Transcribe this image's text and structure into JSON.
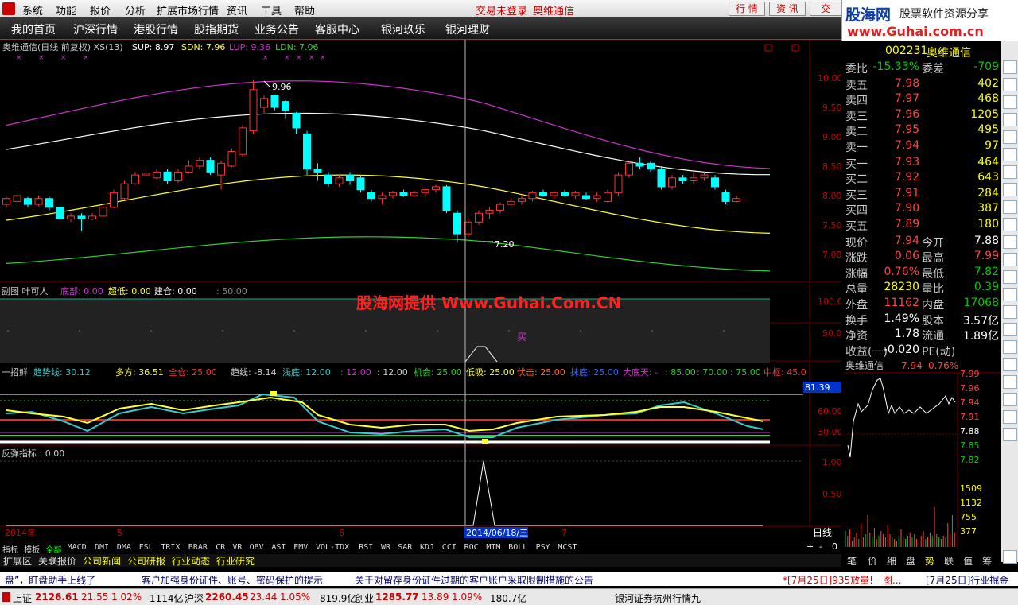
{
  "menu": {
    "items": [
      "系统",
      "功能",
      "报价",
      "分析",
      "扩展市场行情",
      "资讯",
      "工具",
      "帮助"
    ],
    "trade_status": "交易未登录",
    "stock_name": "奥维通信",
    "right_buttons": [
      "行 情",
      "资 讯",
      "交"
    ]
  },
  "logo": {
    "title": "股海网",
    "slogan": "股票软件资源分享",
    "url": "www.Guhai.com.cn"
  },
  "nav": {
    "items": [
      "我的首页",
      "沪深行情",
      "港股行情",
      "股指期货",
      "业务公告",
      "客服中心",
      "银河玖乐",
      "银河理财"
    ]
  },
  "main_chart": {
    "header": "奥维通信(日线 前复权) XS(13)",
    "sup": "SUP: 8.97",
    "sdn": "SDN: 7.96",
    "lup": "LUP: 9.36",
    "ldn": "LDN: 7.06",
    "high_label": "9.96",
    "low_label": "7.20",
    "y_ticks": [
      "10.00",
      "9.50",
      "9.00",
      "8.50",
      "8.00",
      "7.50",
      "7.00"
    ]
  },
  "sub1": {
    "title": "副图  叶可人",
    "v1": "底部: 0.00",
    "v2": "超低: 0.00",
    "v3": "建仓: 0.00",
    "v4": ": 50.00",
    "y_ticks": [
      "100.0",
      "50.00"
    ],
    "buy_mark": "买"
  },
  "watermark": "股海网提供 Www.Guhai.Com.CN",
  "sub2": {
    "title": "一招鲜",
    "v1": "趋势线: 30.12",
    "v2": "多方: 36.51",
    "v3": "全仓: 25.00",
    "v4": "趋线: -8.14",
    "v5": "浅底: 12.00",
    "v6": ": 12.00",
    "v7": ": 12.00",
    "v8": "机会: 25.00",
    "v9": "低吸: 25.00",
    "v10": "伏击: 25.00",
    "v11": "抹底: 25.00",
    "v12": "大底天: -",
    "v13": ": 85.00",
    "v14": ": 70.00",
    "v15": ": 75.00",
    "v16": "中枢: 45.0",
    "y_ticks": [
      "60.00",
      "30.00"
    ],
    "cursor_value": "81.39"
  },
  "sub3": {
    "title": "反弹指标 : 0.00",
    "y_ticks": [
      "1.00",
      "0.50"
    ]
  },
  "date_axis": {
    "labels": [
      "2014年",
      "5",
      "6",
      "7"
    ],
    "cursor_date": "2014/06/18/三",
    "period": "日线"
  },
  "ind_tabs": [
    "指标",
    "模板",
    "全部",
    "MACD",
    "DMI",
    "DMA",
    "FSL",
    "TRIX",
    "BRAR",
    "CR",
    "VR",
    "OBV",
    "ASI",
    "EMV",
    "VOL-TDX",
    "RSI",
    "WR",
    "SAR",
    "KDJ",
    "CCI",
    "ROC",
    "MTM",
    "BOLL",
    "PSY",
    "MCST"
  ],
  "func_tabs": [
    "扩展区",
    "关联报价",
    "公司新闻",
    "公司研报",
    "行业动态",
    "行业研究"
  ],
  "zoom_controls": [
    "+",
    "-",
    "0"
  ],
  "quote": {
    "code": "002231",
    "name": "奥维通信",
    "wb_label": "委比",
    "wb": "-15.33%",
    "wc_label": "委差",
    "wc": "-709",
    "sells": [
      {
        "label": "卖五",
        "price": "7.98",
        "vol": "402"
      },
      {
        "label": "卖四",
        "price": "7.97",
        "vol": "468"
      },
      {
        "label": "卖三",
        "price": "7.96",
        "vol": "1205"
      },
      {
        "label": "卖二",
        "price": "7.95",
        "vol": "495"
      },
      {
        "label": "卖一",
        "price": "7.94",
        "vol": "97"
      }
    ],
    "buys": [
      {
        "label": "买一",
        "price": "7.93",
        "vol": "464"
      },
      {
        "label": "买二",
        "price": "7.92",
        "vol": "643"
      },
      {
        "label": "买三",
        "price": "7.91",
        "vol": "284"
      },
      {
        "label": "买四",
        "price": "7.90",
        "vol": "387"
      },
      {
        "label": "买五",
        "price": "7.89",
        "vol": "180"
      }
    ],
    "stats": [
      {
        "l1": "现价",
        "v1": "7.94",
        "l2": "今开",
        "v2": "7.88",
        "c1": "#f44",
        "c2": "#fff"
      },
      {
        "l1": "涨跌",
        "v1": "0.06",
        "l2": "最高",
        "v2": "7.99",
        "c1": "#f44",
        "c2": "#f44"
      },
      {
        "l1": "涨幅",
        "v1": "0.76%",
        "l2": "最低",
        "v2": "7.82",
        "c1": "#f44",
        "c2": "#0c0"
      },
      {
        "l1": "总量",
        "v1": "28230",
        "l2": "量比",
        "v2": "0.39",
        "c1": "#ff0",
        "c2": "#0c0"
      },
      {
        "l1": "外盘",
        "v1": "11162",
        "l2": "内盘",
        "v2": "17068",
        "c1": "#f44",
        "c2": "#0c0"
      },
      {
        "l1": "换手",
        "v1": "1.49%",
        "l2": "股本",
        "v2": "3.57亿",
        "c1": "#fff",
        "c2": "#fff"
      },
      {
        "l1": "净资",
        "v1": "1.78",
        "l2": "流通",
        "v2": "1.89亿",
        "c1": "#fff",
        "c2": "#fff"
      },
      {
        "l1": "收益(一)",
        "v1": "-0.020",
        "l2": "PE(动)",
        "v2": "",
        "c1": "#fff",
        "c2": "#fff"
      }
    ]
  },
  "mini": {
    "name": "奥维通信",
    "price": "7.94",
    "pct": "0.76%",
    "ticks": [
      "7.99",
      "7.96",
      "7.94",
      "7.91",
      "7.88",
      "7.85",
      "7.82",
      "1509",
      "1132",
      "755",
      "377"
    ]
  },
  "right_tabs": [
    "笔",
    "价",
    "细",
    "盘",
    "势",
    "联",
    "值",
    "筹"
  ],
  "ticker": {
    "t1": "盘”，盯盘助手上线了",
    "t2": "客户加强身份证件、账号、密码保护的提示",
    "t3": "关于对留存身份证件过期的客户账户采取限制措施的公告",
    "t4": "*[7月25日]935放量!一图...",
    "t5": "[7月25日]行业掘金"
  },
  "status": {
    "sh_label": "上证",
    "sh": "2126.61",
    "sh_chg": "21.55",
    "sh_pct": "1.02%",
    "sh_amt": "1114亿",
    "hs_label": "沪深",
    "hs": "2260.45",
    "hs_chg": "23.44",
    "hs_pct": "1.05%",
    "hs_amt": "819.9亿",
    "cy_label": "创业",
    "cy": "1285.77",
    "cy_chg": "13.89",
    "cy_pct": "1.09%",
    "cy_amt": "180.7亿",
    "broker": "银河证券杭州行情九"
  },
  "colors": {
    "up": "#ff3030",
    "down": "#00ffff",
    "purple": "#cc33cc",
    "ma": "#ffff33",
    "green": "#33cc33"
  }
}
